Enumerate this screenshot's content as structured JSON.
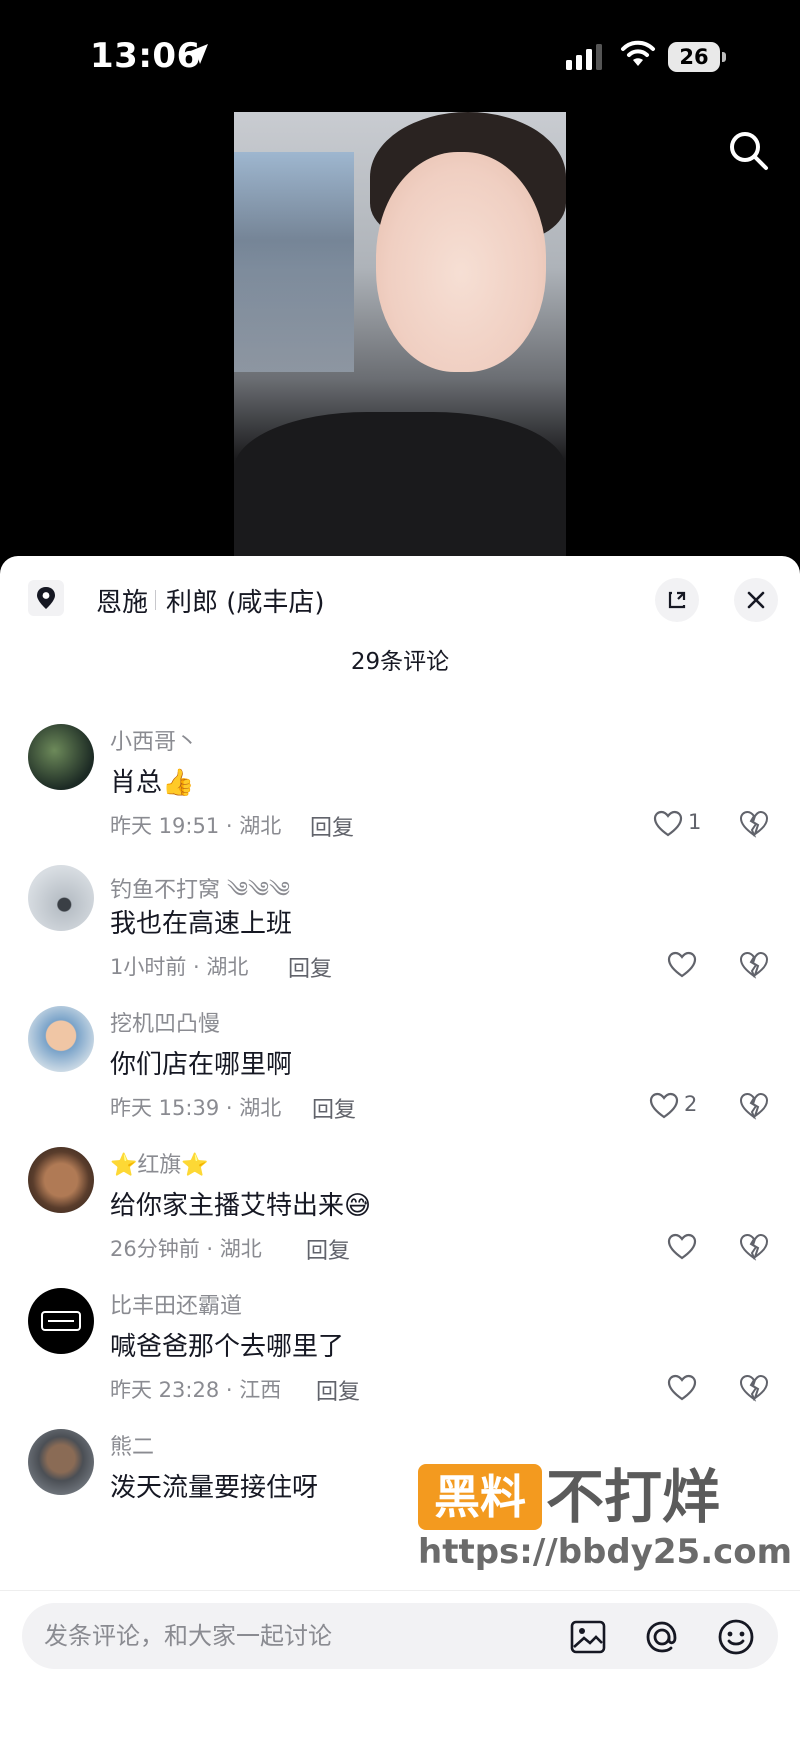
{
  "status_bar": {
    "time": "13:06",
    "battery": "26"
  },
  "location": {
    "city": "恩施",
    "store": "利郎 (咸丰店)"
  },
  "comments_count_label": "29条评论",
  "comments": [
    {
      "username": "小西哥丶",
      "text": "肖总👍",
      "meta": "昨天 19:51 · 湖北",
      "reply": "回复",
      "likes": "1"
    },
    {
      "username": "钓鱼不打窝 ༄༄༄",
      "text": "我也在高速上班",
      "meta": "1小时前 · 湖北",
      "reply": "回复",
      "likes": ""
    },
    {
      "username": "挖机凹凸慢",
      "text": "你们店在哪里啊",
      "meta": "昨天 15:39 · 湖北",
      "reply": "回复",
      "likes": "2"
    },
    {
      "username": "⭐红旗⭐",
      "text": "给你家主播艾特出来😅",
      "meta": "26分钟前 · 湖北",
      "reply": "回复",
      "likes": ""
    },
    {
      "username": "比丰田还霸道",
      "text": "喊爸爸那个去哪里了",
      "meta": "昨天 23:28 · 江西",
      "reply": "回复",
      "likes": ""
    },
    {
      "username": "熊二",
      "text": "泼天流量要接住呀",
      "meta": "",
      "reply": "",
      "likes": ""
    }
  ],
  "watermark": {
    "badge": "黑料",
    "text": "不打烊",
    "url": "https://bbdy25.com"
  },
  "input": {
    "placeholder": "发条评论，和大家一起讨论"
  }
}
